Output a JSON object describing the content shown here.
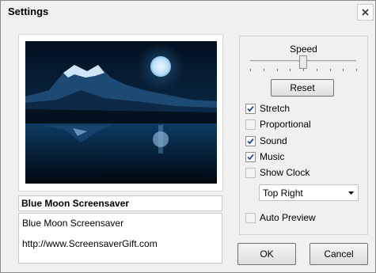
{
  "window": {
    "title": "Settings"
  },
  "preview": {
    "image_desc_icon": "night-mountain-lake-moon",
    "name": "Blue Moon Screensaver",
    "description": "Blue Moon Screensaver",
    "url": "http://www.ScreensaverGift.com"
  },
  "settings": {
    "speed_label": "Speed",
    "speed_value": 0.5,
    "reset_label": "Reset",
    "options": [
      {
        "label": "Stretch",
        "checked": true,
        "enabled": true
      },
      {
        "label": "Proportional",
        "checked": false,
        "enabled": false
      },
      {
        "label": "Sound",
        "checked": true,
        "enabled": true
      },
      {
        "label": "Music",
        "checked": true,
        "enabled": true
      },
      {
        "label": "Show Clock",
        "checked": false,
        "enabled": false
      }
    ],
    "clock_position": "Top Right",
    "auto_preview_label": "Auto Preview",
    "auto_preview_checked": false
  },
  "buttons": {
    "ok": "OK",
    "cancel": "Cancel"
  },
  "colors": {
    "check": "#1e4fa8",
    "background": "#f0f0f0"
  }
}
